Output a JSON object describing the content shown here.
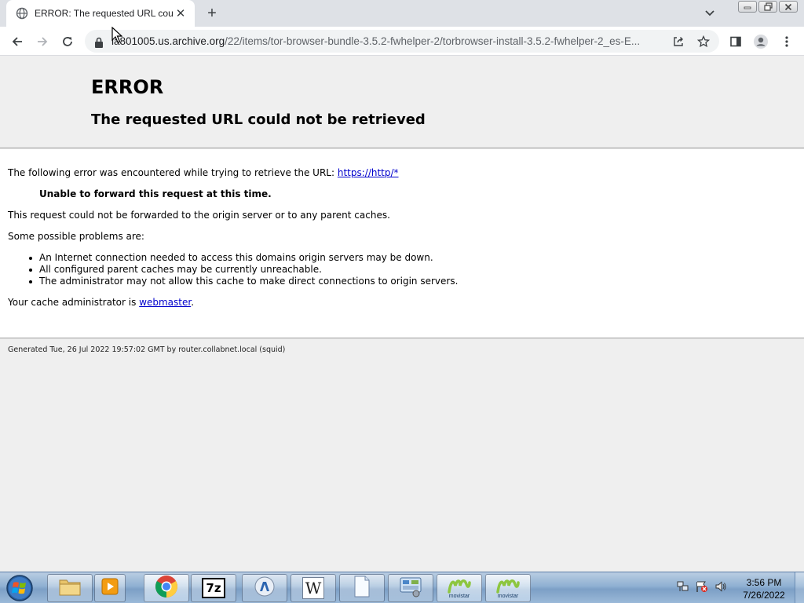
{
  "browser": {
    "tab_title": "ERROR: The requested URL could not be retrieved",
    "new_tab_label": "+",
    "close_tab_label": "✕",
    "url_host": "ia801005.us.archive.org",
    "url_path": "/22/items/tor-browser-bundle-3.5.2-fwhelper-2/torbrowser-install-3.5.2-fwhelper-2_es-E..."
  },
  "page": {
    "heading": "ERROR",
    "subheading": "The requested URL could not be retrieved",
    "intro_text": "The following error was encountered while trying to retrieve the URL: ",
    "intro_link": "https://http/*",
    "error_message": "Unable to forward this request at this time.",
    "explanation": "This request could not be forwarded to the origin server or to any parent caches.",
    "problems_intro": "Some possible problems are:",
    "problems": [
      "An Internet connection needed to access this domains origin servers may be down.",
      "All configured parent caches may be currently unreachable.",
      "The administrator may not allow this cache to make direct connections to origin servers."
    ],
    "admin_text": "Your cache administrator is ",
    "admin_link": "webmaster",
    "admin_suffix": ".",
    "footer": "Generated Tue, 26 Jul 2022 19:57:02 GMT by router.collabnet.local (squid)"
  },
  "taskbar": {
    "apps": [
      {
        "name": "windows-explorer",
        "icon": "folder-icon"
      },
      {
        "name": "media-player",
        "icon": "media-player-icon"
      },
      {
        "name": "google-chrome",
        "icon": "chrome-icon"
      },
      {
        "name": "7-zip",
        "icon": "7zip-icon",
        "label": "7z"
      },
      {
        "name": "app",
        "icon": "app-icon"
      },
      {
        "name": "wordpad",
        "icon": "wordpad-icon",
        "label": "W"
      },
      {
        "name": "notepad",
        "icon": "document-icon"
      },
      {
        "name": "control-panel",
        "icon": "control-panel-icon"
      },
      {
        "name": "movistar-1",
        "icon": "movistar-icon",
        "label": "movistar"
      },
      {
        "name": "movistar-2",
        "icon": "movistar-icon",
        "label": "movistar"
      }
    ],
    "clock_time": "3:56 PM",
    "clock_date": "7/26/2022"
  },
  "colors": {
    "link": "#0000cc",
    "tabstrip": "#dee1e6",
    "page_bg": "#efefef",
    "content_bg": "#ffffff"
  }
}
